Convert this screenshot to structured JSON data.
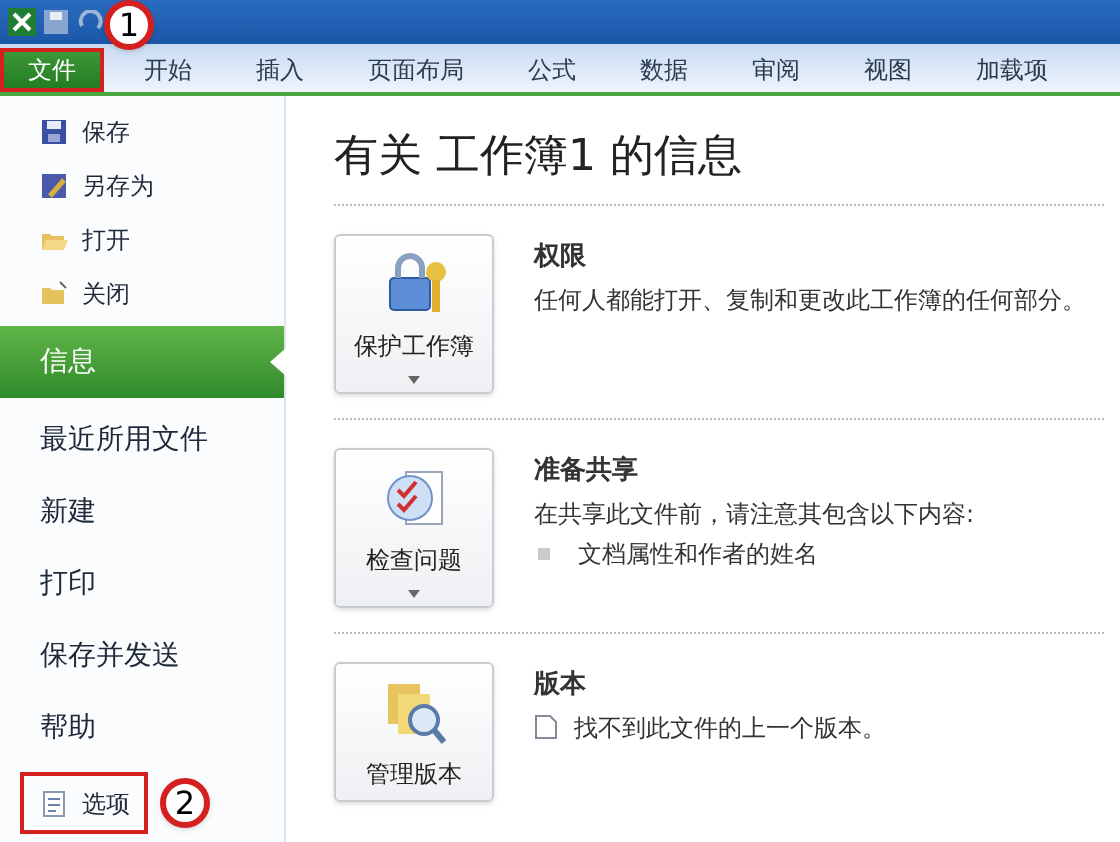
{
  "tabs": [
    {
      "label": "文件",
      "selected": true,
      "kind": "file"
    },
    {
      "label": "开始",
      "selected": false,
      "kind": "tab"
    },
    {
      "label": "插入",
      "selected": false,
      "kind": "tab"
    },
    {
      "label": "页面布局",
      "selected": false,
      "kind": "tab"
    },
    {
      "label": "公式",
      "selected": false,
      "kind": "tab"
    },
    {
      "label": "数据",
      "selected": false,
      "kind": "tab"
    },
    {
      "label": "审阅",
      "selected": false,
      "kind": "tab"
    },
    {
      "label": "视图",
      "selected": false,
      "kind": "tab"
    },
    {
      "label": "加载项",
      "selected": false,
      "kind": "tab"
    }
  ],
  "sidebar": {
    "items": [
      {
        "label": "保存",
        "kind": "small",
        "selected": false
      },
      {
        "label": "另存为",
        "kind": "small",
        "selected": false
      },
      {
        "label": "打开",
        "kind": "small",
        "selected": false
      },
      {
        "label": "关闭",
        "kind": "small",
        "selected": false
      },
      {
        "label": "信息",
        "kind": "big",
        "selected": true
      },
      {
        "label": "最近所用文件",
        "kind": "big",
        "selected": false
      },
      {
        "label": "新建",
        "kind": "big",
        "selected": false
      },
      {
        "label": "打印",
        "kind": "big",
        "selected": false
      },
      {
        "label": "保存并发送",
        "kind": "big",
        "selected": false
      },
      {
        "label": "帮助",
        "kind": "big",
        "selected": false
      },
      {
        "label": "选项",
        "kind": "small",
        "selected": false
      }
    ]
  },
  "main": {
    "title": "有关 工作簿1 的信息",
    "sections": [
      {
        "button": "保护工作簿",
        "heading": "权限",
        "lines": [
          {
            "text": "任何人都能打开、复制和更改此工作簿的任何部分。",
            "kind": "plain"
          }
        ]
      },
      {
        "button": "检查问题",
        "heading": "准备共享",
        "lines": [
          {
            "text": "在共享此文件前，请注意其包含以下内容:",
            "kind": "plain"
          },
          {
            "text": "文档属性和作者的姓名",
            "kind": "bullet"
          }
        ]
      },
      {
        "button": "管理版本",
        "heading": "版本",
        "lines": [
          {
            "text": "找不到此文件的上一个版本。",
            "kind": "note"
          }
        ]
      }
    ]
  },
  "callouts": [
    {
      "number": "1"
    },
    {
      "number": "2"
    }
  ]
}
